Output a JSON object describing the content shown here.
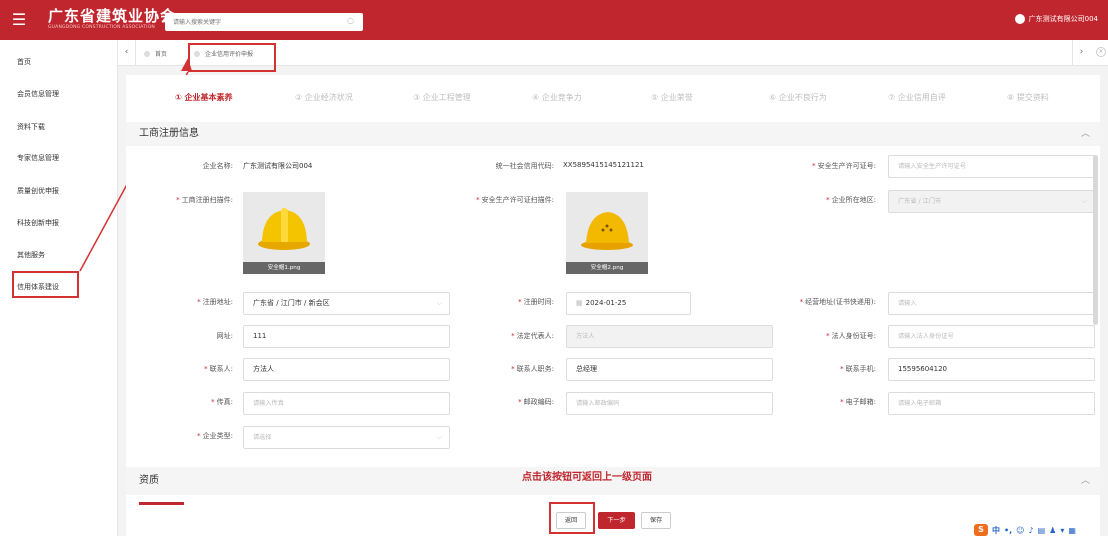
{
  "header": {
    "menu_icon": "menu-icon",
    "title": "广东省建筑业协会",
    "subtitle": "GUANGDONG CONSTRUCTION ASSOCIATION",
    "search_placeholder": "请输入搜索关键字",
    "search_icon": "search-icon",
    "user_name": "广东测试有限公司004"
  },
  "sidebar": {
    "items": [
      {
        "label": "首页"
      },
      {
        "label": "会员信息管理"
      },
      {
        "label": "资料下载"
      },
      {
        "label": "专家信息管理"
      },
      {
        "label": "质量创优申报"
      },
      {
        "label": "科技创新申报"
      },
      {
        "label": "其他服务"
      },
      {
        "label": "信用体系建设"
      }
    ]
  },
  "tabs": {
    "home": "首页",
    "active": "企业信用评价申报"
  },
  "steps": [
    "① 企业基本素养",
    "② 企业经济状况",
    "③ 企业工程管理",
    "④ 企业竞争力",
    "⑤ 企业荣誉",
    "⑥ 企业不良行为",
    "⑦ 企业信用自评",
    "⑧ 提交资料"
  ],
  "section_business": {
    "title": "工商注册信息",
    "labels": {
      "company_name": "企业名称:",
      "credit_code": "统一社会信用代码:",
      "safety_license": "安全生产许可证号:",
      "reg_scan": "工商注册扫描件:",
      "safety_scan": "安全生产许可证扫描件:",
      "region": "企业所在地区:",
      "reg_address": "注册地址:",
      "reg_time": "注册时间:",
      "biz_address": "经营地址(证书快递用):",
      "website": "网址:",
      "legal_rep": "法定代表人:",
      "legal_id": "法人身份证号:",
      "contact": "联系人:",
      "contact_title": "联系人职务:",
      "phone": "联系手机:",
      "fax": "传真:",
      "postcode": "邮政编码:",
      "email": "电子邮箱:",
      "company_type": "企业类型:"
    },
    "values": {
      "company_name": "广东测试有限公司004",
      "credit_code": "XX5895415145121121",
      "safety_license_ph": "请输入安全生产许可证号",
      "reg_scan_file": "安全帽1.png",
      "safety_scan_file": "安全帽2.png",
      "region": "广东省 / 江门市",
      "reg_address": "广东省 / 江门市 / 新会区",
      "reg_time": "2024-01-25",
      "biz_address_ph": "请输入",
      "website": "111",
      "legal_rep_ph": "方法人",
      "legal_id_ph": "请输入法人身份证号",
      "contact": "方法人",
      "contact_title": "总经理",
      "phone": "15595604120",
      "fax_ph": "请输入传真",
      "postcode_ph": "请输入邮政编码",
      "email_ph": "请输入电子邮箱",
      "company_type_ph": "请选择"
    }
  },
  "section_quals": {
    "title": "资质"
  },
  "annotation_hint": "点击该按钮可返回上一级页面",
  "buttons": {
    "back": "返回",
    "next": "下一步",
    "save": "保存"
  },
  "ime": {
    "logo": "S",
    "mode": "中"
  },
  "colors": {
    "brand": "#c0262d",
    "annotation": "#d33232"
  }
}
